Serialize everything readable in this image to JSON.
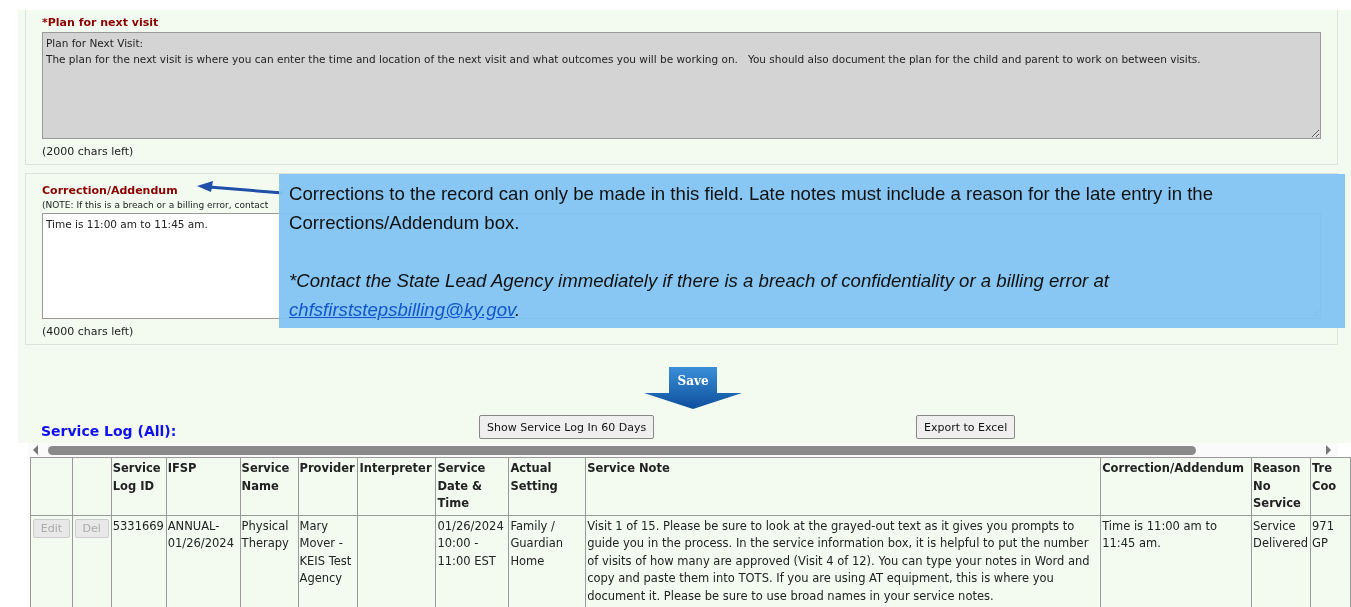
{
  "plan_section": {
    "label": "*Plan for next visit",
    "value": "Plan for Next Visit:\nThe plan for the next visit is where you can enter the time and location of the next visit and what outcomes you will be working on.   You should also document the plan for the child and parent to work on between visits.",
    "disabled": true,
    "chars_left": "(2000 chars left)"
  },
  "correction_section": {
    "label": "Correction/Addendum",
    "note": "(NOTE: If this is a breach or a billing error, contact",
    "value": "Time is 11:00 am to 11:45 am.",
    "disabled": false,
    "chars_left": "(4000 chars left)"
  },
  "callout": {
    "text": "Corrections to the record can only be made in this field. Late notes must include a reason for the late entry in the Corrections/Addendum box.",
    "warning": "*Contact the State Lead Agency immediately if there is a breach of confidentiality or a billing error at",
    "link": "chfsfirststepsbilling@ky.gov",
    "after_link": "."
  },
  "save_button": "Save",
  "service_log": {
    "title": "Service Log (All):",
    "buttons": [
      "Show Service Log In 60 Days",
      "Export to Excel"
    ],
    "columns": [
      "",
      "",
      "Service Log ID",
      "IFSP",
      "Service Name",
      "Provider",
      "Interpreter",
      "Service Date & Time",
      "Actual Setting",
      "Service Note",
      "Correction/Addendum",
      "Reason No Service",
      "Tre Coo"
    ],
    "rows": [
      {
        "cells": [
          {
            "kind": "button",
            "text": "Edit",
            "disabled": true
          },
          {
            "kind": "button",
            "text": "Del",
            "disabled": true
          },
          {
            "kind": "text",
            "text": "5331669"
          },
          {
            "kind": "text",
            "text": "ANNUAL-01/26/2024"
          },
          {
            "kind": "text",
            "text": "Physical Therapy"
          },
          {
            "kind": "text",
            "text": "Mary Mover - KEIS Test Agency"
          },
          {
            "kind": "text",
            "text": ""
          },
          {
            "kind": "text",
            "text": "01/26/2024 10:00 - 11:00 EST"
          },
          {
            "kind": "text",
            "text": "Family / Guardian Home"
          },
          {
            "kind": "text",
            "text": "Visit 1 of 15. Please be sure to look at the grayed-out text as it gives you prompts to guide you in the process. In the service information box, it is helpful to put the number of visits of how many are approved (Visit 4 of 12). You can type your notes in Word and copy and paste them into TOTS. If you are using AT equipment, this is where you document it. Please be sure to use broad names in your service notes."
          },
          {
            "kind": "text",
            "text": "Time is 11:00 am to 11:45 am."
          },
          {
            "kind": "text",
            "text": "Service Delivered"
          },
          {
            "kind": "text",
            "text": "971 GP"
          }
        ]
      }
    ]
  }
}
